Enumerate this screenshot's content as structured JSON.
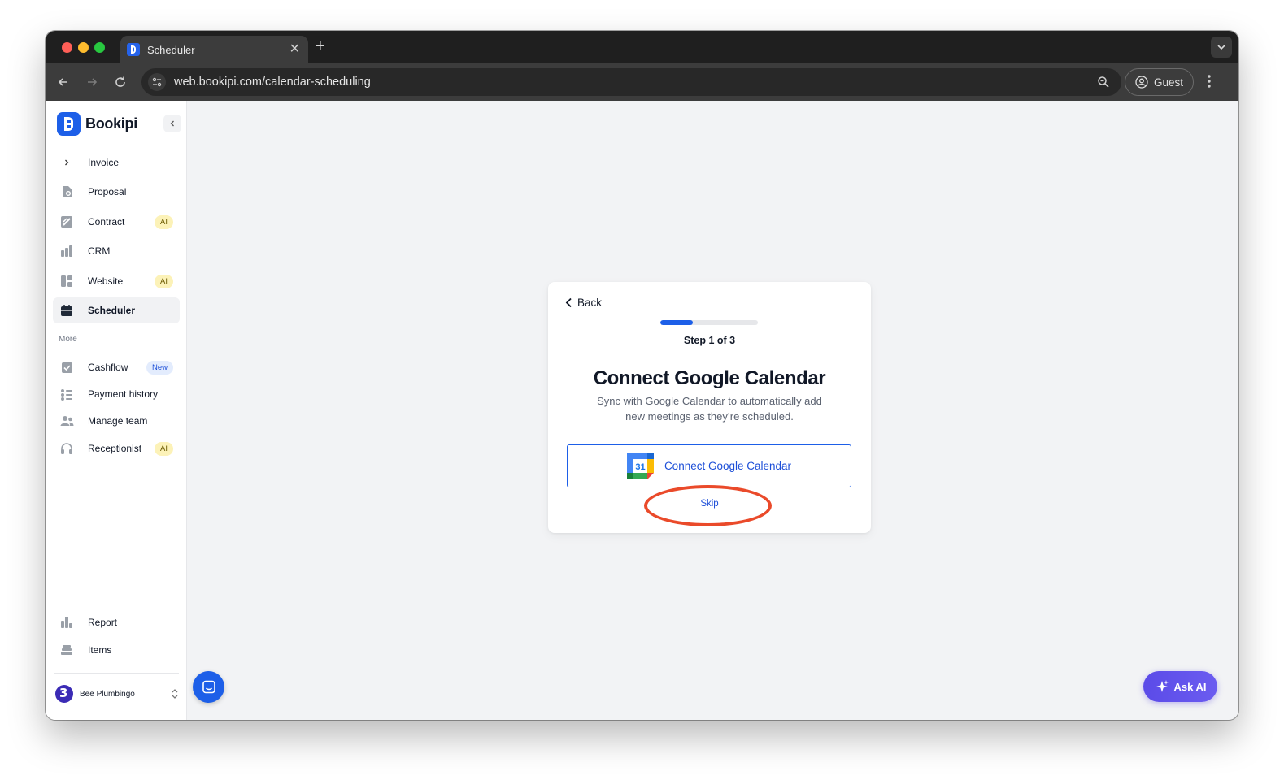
{
  "browser": {
    "tab_title": "Scheduler",
    "url": "web.bookipi.com/calendar-scheduling",
    "profile_label": "Guest"
  },
  "sidebar": {
    "brand": "Bookipi",
    "items": [
      {
        "label": "Invoice",
        "icon": "chevron-right-icon"
      },
      {
        "label": "Proposal",
        "icon": "proposal-icon"
      },
      {
        "label": "Contract",
        "icon": "contract-icon",
        "badge": "AI"
      },
      {
        "label": "CRM",
        "icon": "crm-icon"
      },
      {
        "label": "Website",
        "icon": "website-icon",
        "badge": "AI"
      },
      {
        "label": "Scheduler",
        "icon": "calendar-icon",
        "active": true
      }
    ],
    "more_label": "More",
    "more_items": [
      {
        "label": "Cashflow",
        "icon": "cashflow-icon",
        "badge": "New"
      },
      {
        "label": "Payment history",
        "icon": "payment-history-icon"
      },
      {
        "label": "Manage team",
        "icon": "team-icon"
      },
      {
        "label": "Receptionist",
        "icon": "headset-icon",
        "badge": "AI"
      }
    ],
    "bottom_items": [
      {
        "label": "Report",
        "icon": "report-icon"
      },
      {
        "label": "Items",
        "icon": "items-icon"
      }
    ],
    "account_name": "Bee Plumbingo"
  },
  "onboarding": {
    "back_label": "Back",
    "step_text": "Step 1 of 3",
    "progress": 0.33,
    "title": "Connect Google Calendar",
    "description": "Sync with Google Calendar to automatically add new meetings as they’re scheduled.",
    "connect_label": "Connect Google Calendar",
    "calendar_icon_number": "31",
    "skip_label": "Skip"
  },
  "ask_ai_label": "Ask AI",
  "colors": {
    "accent": "#1d5fe8",
    "highlight": "#ea4a2a",
    "ask_ai": "#5b4be8"
  }
}
